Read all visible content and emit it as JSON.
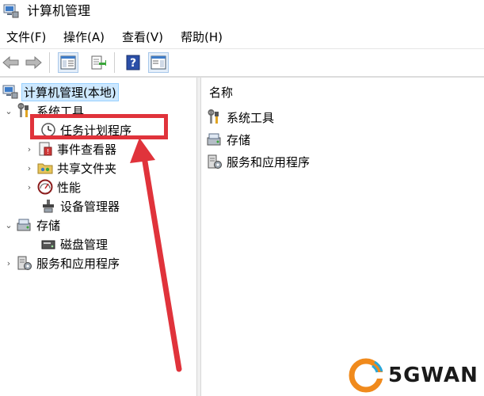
{
  "window": {
    "title": "计算机管理"
  },
  "menu": [
    {
      "label": "文件(F)"
    },
    {
      "label": "操作(A)"
    },
    {
      "label": "查看(V)"
    },
    {
      "label": "帮助(H)"
    }
  ],
  "toolbar": {
    "icons": [
      "back-arrow-icon",
      "forward-arrow-icon",
      "show-tree-icon",
      "export-list-icon",
      "help-icon",
      "action-pane-icon"
    ]
  },
  "tree": {
    "root": {
      "label": "计算机管理(本地)",
      "icon": "computer-management-icon"
    },
    "items": [
      {
        "label": "系统工具",
        "icon": "tools-icon",
        "expanded": true
      },
      {
        "label": "任务计划程序",
        "icon": "clock-icon"
      },
      {
        "label": "事件查看器",
        "icon": "event-viewer-icon"
      },
      {
        "label": "共享文件夹",
        "icon": "shared-folder-icon"
      },
      {
        "label": "性能",
        "icon": "performance-icon"
      },
      {
        "label": "设备管理器",
        "icon": "device-manager-icon"
      },
      {
        "label": "存储",
        "icon": "storage-icon",
        "expanded": true
      },
      {
        "label": "磁盘管理",
        "icon": "disk-management-icon"
      },
      {
        "label": "服务和应用程序",
        "icon": "services-icon"
      }
    ]
  },
  "list": {
    "header": "名称",
    "rows": [
      {
        "label": "系统工具",
        "icon": "tools-icon"
      },
      {
        "label": "存储",
        "icon": "storage-icon"
      },
      {
        "label": "服务和应用程序",
        "icon": "services-icon"
      }
    ]
  },
  "annotation": {
    "color": "#e0333b"
  },
  "watermark": {
    "text": "5GWAN"
  }
}
